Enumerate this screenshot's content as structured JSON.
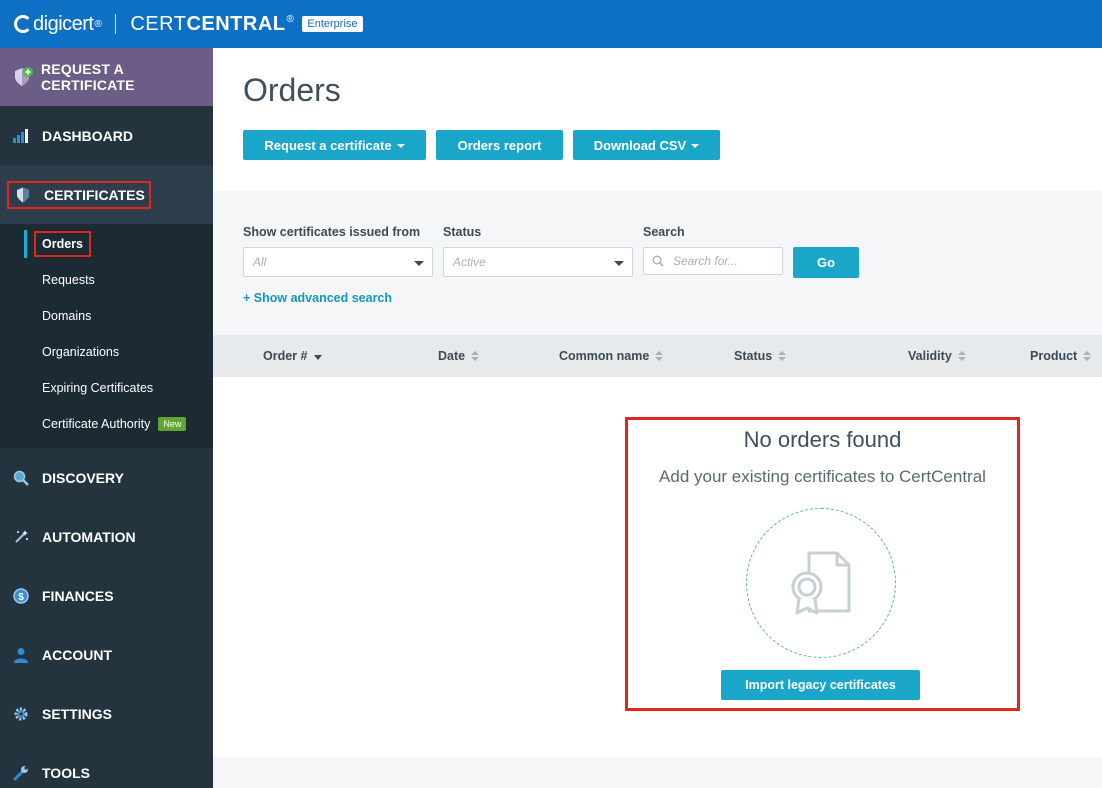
{
  "header": {
    "logo_text": "digicert",
    "logo_reg": "®",
    "product_thin": "CERT",
    "product_bold": "CENTRAL",
    "product_reg": "®",
    "edition_badge": "Enterprise"
  },
  "sidebar": {
    "request_cert": "REQUEST A CERTIFICATE",
    "items": [
      {
        "label": "DASHBOARD",
        "icon": "bar-chart-icon"
      },
      {
        "label": "CERTIFICATES",
        "icon": "shield-icon"
      },
      {
        "label": "DISCOVERY",
        "icon": "magnifier-icon"
      },
      {
        "label": "AUTOMATION",
        "icon": "magic-wand-icon"
      },
      {
        "label": "FINANCES",
        "icon": "dollar-coin-icon"
      },
      {
        "label": "ACCOUNT",
        "icon": "user-icon"
      },
      {
        "label": "SETTINGS",
        "icon": "gear-icon"
      },
      {
        "label": "TOOLS",
        "icon": "wrench-icon"
      }
    ],
    "sub_items": [
      {
        "label": "Orders"
      },
      {
        "label": "Requests"
      },
      {
        "label": "Domains"
      },
      {
        "label": "Organizations"
      },
      {
        "label": "Expiring Certificates"
      },
      {
        "label": "Certificate Authority",
        "badge": "New"
      }
    ]
  },
  "main": {
    "title": "Orders",
    "buttons": {
      "request": "Request a certificate",
      "report": "Orders report",
      "csv": "Download CSV"
    },
    "filters": {
      "issued_label": "Show certificates issued from",
      "issued_value": "All",
      "status_label": "Status",
      "status_value": "Active",
      "search_label": "Search",
      "search_placeholder": "Search for...",
      "go": "Go",
      "advanced": "+ Show advanced search"
    },
    "table_headers": [
      "Order #",
      "Date",
      "Common name",
      "Status",
      "Validity",
      "Product"
    ],
    "empty": {
      "title": "No orders found",
      "subtitle": "Add your existing certificates to CertCentral",
      "button": "Import legacy certificates"
    }
  },
  "colors": {
    "topbar": "#0d70c4",
    "sidebar": "#24343f",
    "request_band": "#6c5d87",
    "accent": "#19a6c8",
    "highlight": "#e0261e",
    "new_badge": "#5fa634"
  }
}
